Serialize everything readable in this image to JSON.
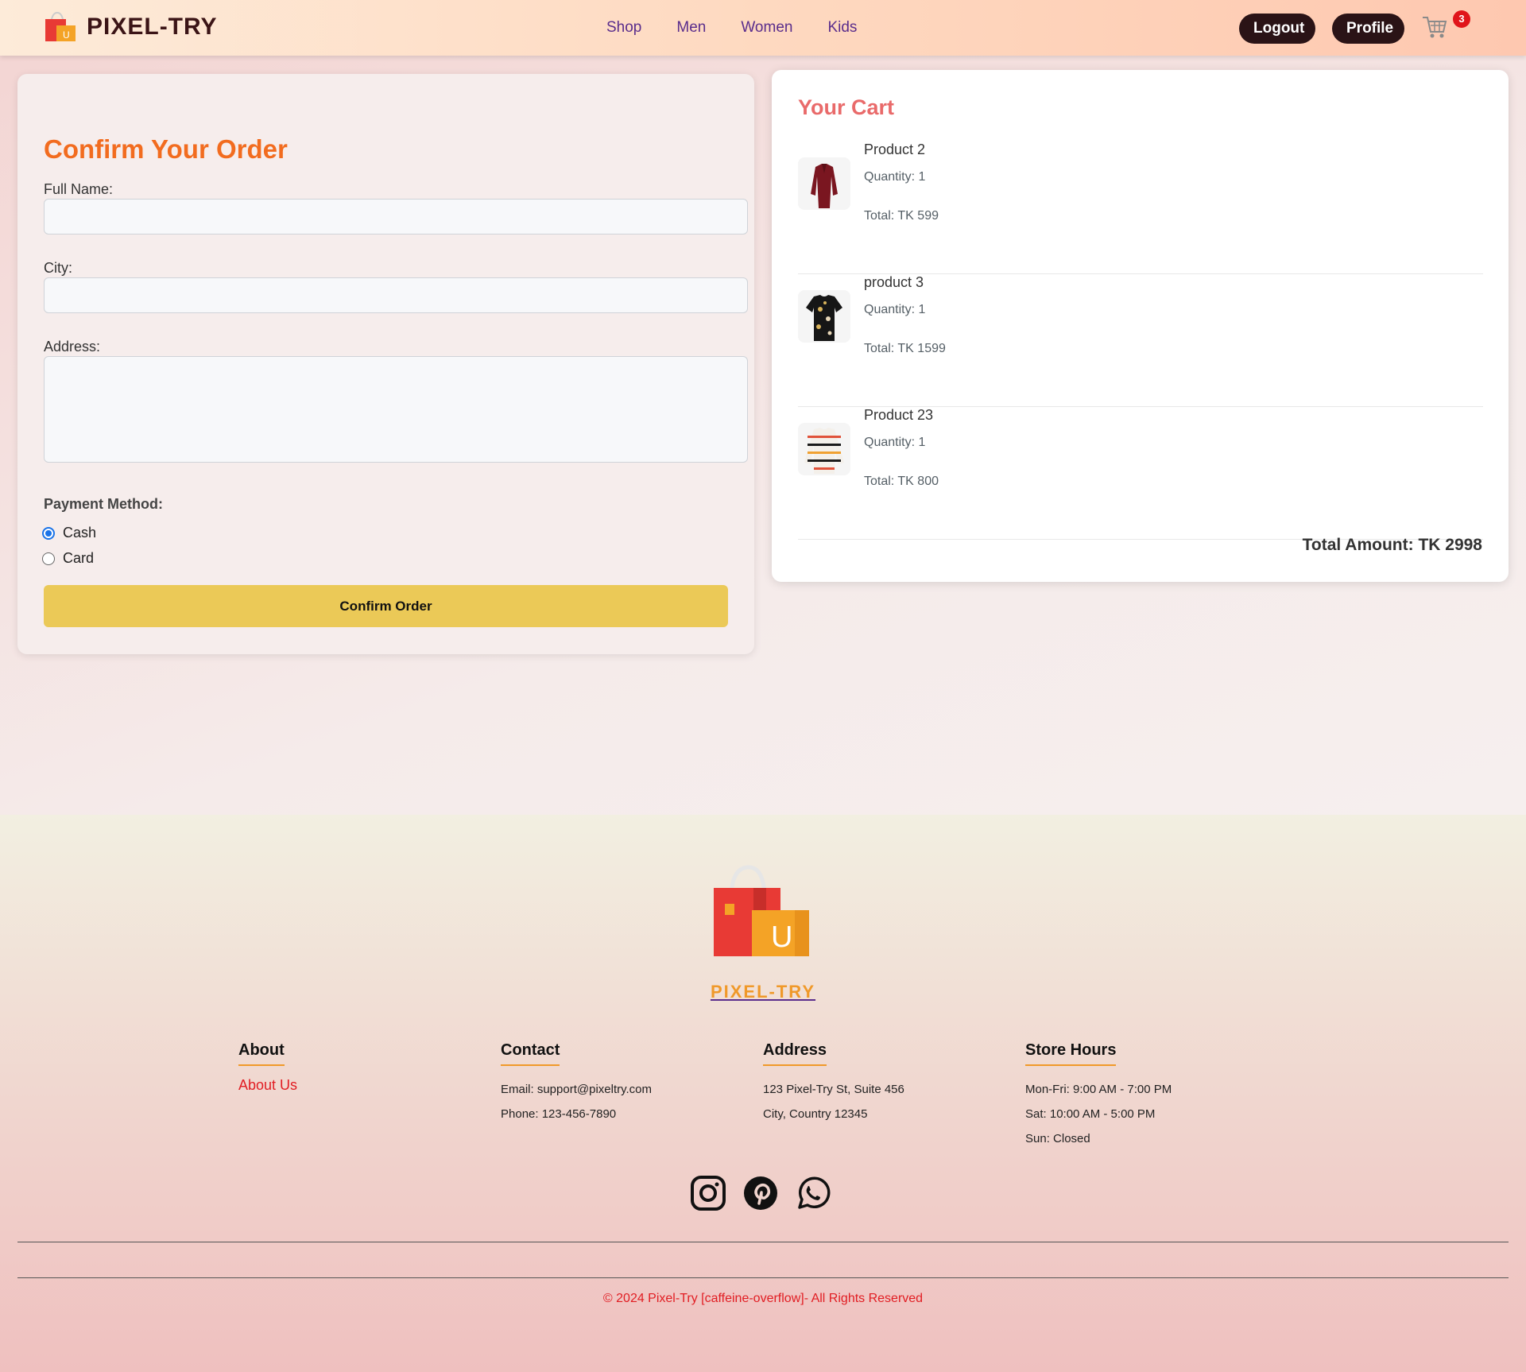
{
  "navbar": {
    "brand": "PIXEL-TRY",
    "links": [
      "Shop",
      "Men",
      "Women",
      "Kids"
    ],
    "logout_label": "Logout",
    "profile_label": "Profile",
    "cart_count": "3"
  },
  "order_form": {
    "title": "Confirm Your Order",
    "full_name_label": "Full Name:",
    "city_label": "City:",
    "address_label": "Address:",
    "full_name_value": "",
    "city_value": "",
    "address_value": "",
    "payment_label": "Payment Method:",
    "payment_options": [
      "Cash",
      "Card"
    ],
    "payment_selected": "Cash",
    "confirm_label": "Confirm Order"
  },
  "cart": {
    "title": "Your Cart",
    "items": [
      {
        "name": "Product 2",
        "quantity": "Quantity: 1",
        "total": "Total: TK 599"
      },
      {
        "name": "product 3",
        "quantity": "Quantity: 1",
        "total": "Total: TK 1599"
      },
      {
        "name": "Product 23",
        "quantity": "Quantity: 1",
        "total": "Total: TK 800"
      }
    ],
    "total_amount": "Total Amount: TK 2998"
  },
  "footer": {
    "brand": "PIXEL-TRY",
    "about": {
      "heading": "About",
      "link": "About Us"
    },
    "contact": {
      "heading": "Contact",
      "email": "Email: support@pixeltry.com",
      "phone": "Phone: 123-456-7890"
    },
    "address": {
      "heading": "Address",
      "line1": "123 Pixel-Try St, Suite 456",
      "line2": "City, Country 12345"
    },
    "hours": {
      "heading": "Store Hours",
      "weekdays": "Mon-Fri: 9:00 AM - 7:00 PM",
      "saturday": "Sat: 10:00 AM - 5:00 PM",
      "sunday": "Sun: Closed"
    },
    "socials": [
      "instagram-icon",
      "pinterest-icon",
      "whatsapp-icon"
    ],
    "copyright": "© 2024 Pixel-Try [caffeine-overflow]- All Rights Reserved"
  },
  "colors": {
    "accent_orange": "#f26c1f",
    "cart_title": "#e96a6a",
    "confirm_button": "#ebc957",
    "dark_button": "#2a1316",
    "link_red": "#e11d23"
  }
}
